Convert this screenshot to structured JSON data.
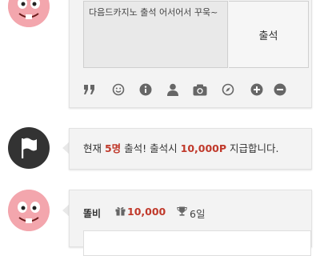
{
  "compose": {
    "message": "다음드카지노 출석 어서어서 꾸욱~",
    "submit_label": "출석"
  },
  "toolbar": {
    "icons": [
      "quote-icon",
      "smile-icon",
      "info-icon",
      "user-icon",
      "camera-icon",
      "compass-icon",
      "plus-icon",
      "minus-icon"
    ]
  },
  "notice": {
    "prefix": "현재 ",
    "count": "5명",
    "middle": " 출석! 출석시 ",
    "reward": "10,000P",
    "suffix": " 지급합니다."
  },
  "entry": {
    "username": "똘비",
    "points": "10,000",
    "days": "6일"
  },
  "colors": {
    "accent": "#c0392b",
    "avatar_pink": "#f3a6ad",
    "card_bg": "#f3f3f3",
    "icon_gray": "#666666"
  }
}
